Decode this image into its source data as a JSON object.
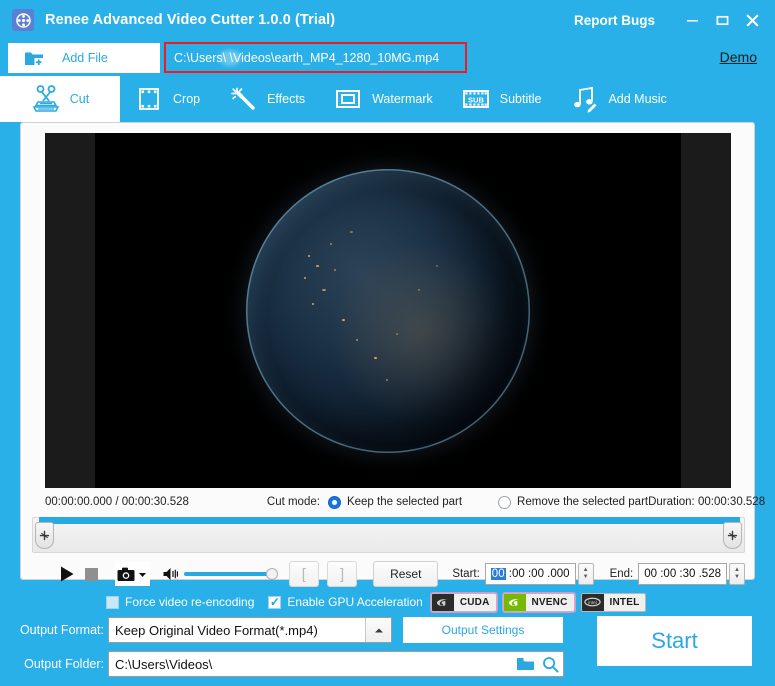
{
  "titlebar": {
    "app_icon": "film-reel-icon",
    "title": "Renee Advanced Video Cutter 1.0.0 (Trial)",
    "report_bugs": "Report Bugs",
    "minimize": "minimize-icon",
    "maximize": "maximize-icon",
    "close": "close-icon"
  },
  "filebar": {
    "add_file_label": "Add File",
    "file_path": "C:\\Users\\          \\Videos\\earth_MP4_1280_10MG.mp4",
    "demo_label": "Demo"
  },
  "tabs": [
    {
      "label": "Cut",
      "icon": "scissors-icon",
      "active": true
    },
    {
      "label": "Crop",
      "icon": "film-crop-icon",
      "active": false
    },
    {
      "label": "Effects",
      "icon": "magic-wand-icon",
      "active": false
    },
    {
      "label": "Watermark",
      "icon": "frame-icon",
      "active": false
    },
    {
      "label": "Subtitle",
      "icon": "sub-film-icon",
      "active": false
    },
    {
      "label": "Add Music",
      "icon": "music-note-icon",
      "active": false
    }
  ],
  "preview": {
    "time_display": "00:00:00.000 / 00:00:30.528",
    "cut_mode_label": "Cut mode:",
    "cut_mode_keep": "Keep the selected part",
    "cut_mode_remove": "Remove the selected part",
    "cut_mode_selected": "keep",
    "duration_display": "Duration: 00:00:30.528"
  },
  "controls": {
    "play": "play-icon",
    "stop": "stop-icon",
    "snapshot": "camera-icon",
    "snapshot_arrow": "chevron-down-icon",
    "volume": "speaker-icon",
    "volume_percent": 88,
    "mark_in": "[",
    "mark_out": "]",
    "reset_label": "Reset",
    "start": {
      "label": "Start:",
      "hours": "00",
      "minutes": "00",
      "seconds": "00",
      "millis": ".000",
      "selected_segment": "hours"
    },
    "end": {
      "label": "End:",
      "hours": "00",
      "minutes": "00",
      "seconds": "30",
      "millis": ".528"
    }
  },
  "options": {
    "force_reencode_label": "Force video re-encoding",
    "force_reencode_checked": false,
    "gpu_accel_label": "Enable GPU Acceleration",
    "gpu_accel_checked": true,
    "badges": [
      {
        "name": "CUDA",
        "text": "CUDA"
      },
      {
        "name": "NVENC",
        "text": "NVENC"
      },
      {
        "name": "INTEL",
        "text": "INTEL"
      }
    ]
  },
  "output": {
    "format_label": "Output Format:",
    "format_value": "Keep Original Video Format(*.mp4)",
    "format_arrow": "chevron-up-icon",
    "settings_label": "Output Settings",
    "folder_label": "Output Folder:",
    "folder_value": "C:\\Users\\Videos\\",
    "browse_icon": "folder-icon",
    "search_icon": "magnifier-icon",
    "start_label": "Start"
  },
  "colors": {
    "brand_blue": "#29b0e8",
    "accent_blue": "#2aa9e0",
    "slider_blue": "#27a9e1",
    "highlight_red": "#ee1b24",
    "nvidia_green": "#76b900",
    "select_blue": "#2a7fd4"
  }
}
